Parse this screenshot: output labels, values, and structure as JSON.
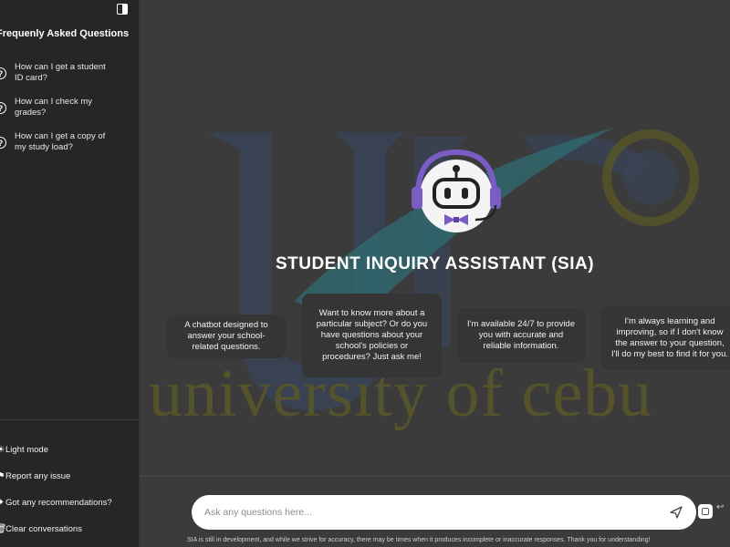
{
  "sidebar": {
    "faq_title": "Frequenly Asked Questions",
    "faq_items": [
      {
        "label": "How can I get a student ID card?"
      },
      {
        "label": "How can I check my grades?"
      },
      {
        "label": "How can I get a copy of my study load?"
      }
    ],
    "bottom_items": [
      {
        "label": "Light mode",
        "icon": "sun-icon"
      },
      {
        "label": "Report any issue",
        "icon": "flag-icon"
      },
      {
        "label": "Got any recommendations?",
        "icon": "lightbulb-icon"
      },
      {
        "label": "Clear conversations",
        "icon": "trash-icon"
      }
    ]
  },
  "main": {
    "watermark_text": "university of cebu",
    "title": "STUDENT INQUIRY ASSISTANT (SIA)",
    "cards": [
      "A chatbot designed to answer your school-related questions.",
      "Want to know more about a particular subject? Or do you have questions about your school's policies or procedures? Just ask me!",
      "I'm available 24/7 to provide you with accurate and reliable information.",
      "I'm always learning and improving, so if I don't know the answer to your question, I'll do my best to find it for you."
    ],
    "input_placeholder": "Ask any questions here...",
    "disclaimer": "SIA is still in development, and while we strive for accuracy, there may be times when it produces incomplete or inaccurate responses. Thank you for understanding!"
  },
  "colors": {
    "accent": "#7b5cc4",
    "sidebar_bg": "#262626",
    "main_bg": "#3b3b3b",
    "watermark": "#54532c"
  }
}
